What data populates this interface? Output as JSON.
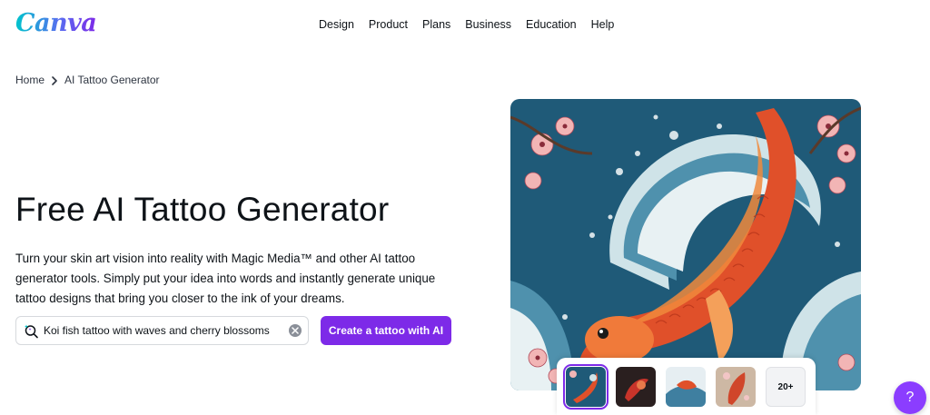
{
  "brand": {
    "logo_text": "Canva"
  },
  "nav": {
    "items": [
      {
        "label": "Design"
      },
      {
        "label": "Product"
      },
      {
        "label": "Plans"
      },
      {
        "label": "Business"
      },
      {
        "label": "Education"
      },
      {
        "label": "Help"
      }
    ]
  },
  "breadcrumb": {
    "home": "Home",
    "current": "AI Tattoo Generator"
  },
  "hero": {
    "title": "Free AI Tattoo Generator",
    "description": "Turn your skin art vision into reality with Magic Media™ and other AI tattoo generator tools. Simply put your idea into words and instantly generate unique tattoo designs that bring you closer to the ink of your dreams."
  },
  "search": {
    "value": "Koi fish tattoo with waves and cherry blossoms",
    "icon": "magic-search-icon",
    "clear_icon": "clear-icon"
  },
  "cta": {
    "label": "Create a tattoo with AI"
  },
  "thumbnails": {
    "more_label": "20+",
    "selected_index": 0
  },
  "help": {
    "label": "?"
  },
  "colors": {
    "accent": "#7d2ae8",
    "help_button": "#8b3dff",
    "artwork_background": "#1f5a78",
    "koi_orange": "#e0502a"
  }
}
